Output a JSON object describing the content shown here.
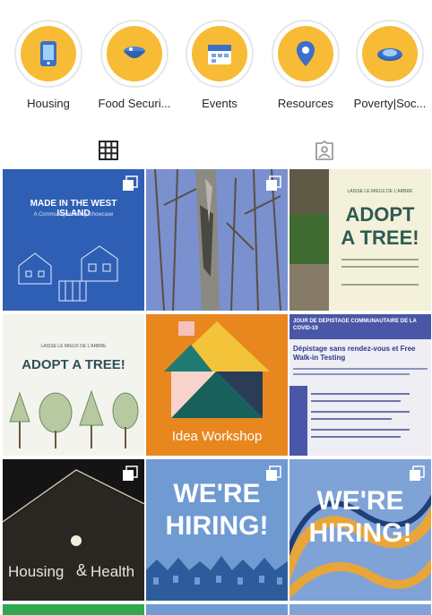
{
  "highlights": [
    {
      "label": "Housing",
      "icon": "phone-icon"
    },
    {
      "label": "Food Securi...",
      "icon": "food-bowl-icon"
    },
    {
      "label": "Events",
      "icon": "calendar-icon"
    },
    {
      "label": "Resources",
      "icon": "map-pin-icon"
    },
    {
      "label": "Poverty|Soc...",
      "icon": "hands-icon"
    }
  ],
  "tabs": {
    "grid": "grid-icon",
    "tagged": "tagged-icon"
  },
  "posts": [
    {
      "title": "MADE IN THE WEST ISLAND",
      "subtitle": "A Community Housing Showcase",
      "bg": "#2f5fb5"
    },
    {
      "title": "",
      "bg": "#6f86c9"
    },
    {
      "kicker": "LAISSE LE MIEUX DE L'ARBRE",
      "title1": "ADOPT",
      "title2": "A TREE!",
      "bg": "#f3f1d9"
    },
    {
      "kicker": "LAISSE LE MIEUX DE L'ARBRE",
      "title": "ADOPT A TREE!",
      "bg": "#f4f4ee"
    },
    {
      "title": "Idea Workshop",
      "bg": "#e8871e"
    },
    {
      "heading": "JOUR DE DEPISTAGE COMMUNAUTAIRE DE LA COVID-19",
      "line": "Dépistage sans rendez-vous et Free Walk-in Testing",
      "bg": "#eeeef4"
    },
    {
      "title1": "Housing",
      "amp": "&",
      "title2": "Health",
      "bg": "#141414"
    },
    {
      "title1": "WE'RE",
      "title2": "HIRING!",
      "bg": "#6f9ad2"
    },
    {
      "title1": "WE'RE",
      "title2": "HIRING!",
      "bg": "#7fa3d6"
    }
  ]
}
